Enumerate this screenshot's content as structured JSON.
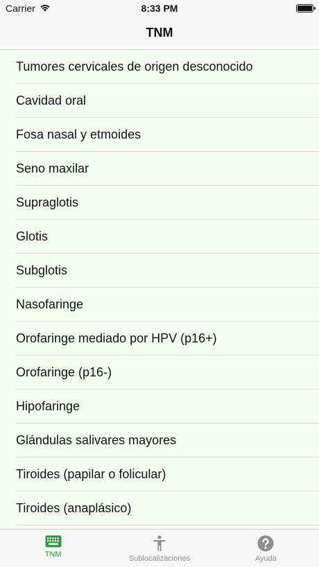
{
  "status": {
    "carrier": "Carrier",
    "time": "8:33 PM"
  },
  "nav": {
    "title": "TNM"
  },
  "list": {
    "items": [
      "Tumores cervicales de origen desconocido",
      "Cavidad oral",
      "Fosa nasal y etmoides",
      "Seno maxilar",
      "Supraglotis",
      "Glotis",
      "Subglotis",
      "Nasofaringe",
      "Orofaringe mediado por HPV (p16+)",
      "Orofaringe (p16-)",
      "Hipofaringe",
      "Glándulas salivares mayores",
      "Tiroides (papilar o folicular)",
      "Tiroides (anaplásico)"
    ]
  },
  "tabs": [
    {
      "label": "TNM",
      "icon": "keyboard-icon",
      "active": true
    },
    {
      "label": "Sublocalizaciones",
      "icon": "person-icon",
      "active": false
    },
    {
      "label": "Ayuda",
      "icon": "question-icon",
      "active": false
    }
  ],
  "colors": {
    "active_tab": "#2e9a3e",
    "inactive_tab": "#8e8e8e",
    "list_background": "#f4fff0"
  }
}
